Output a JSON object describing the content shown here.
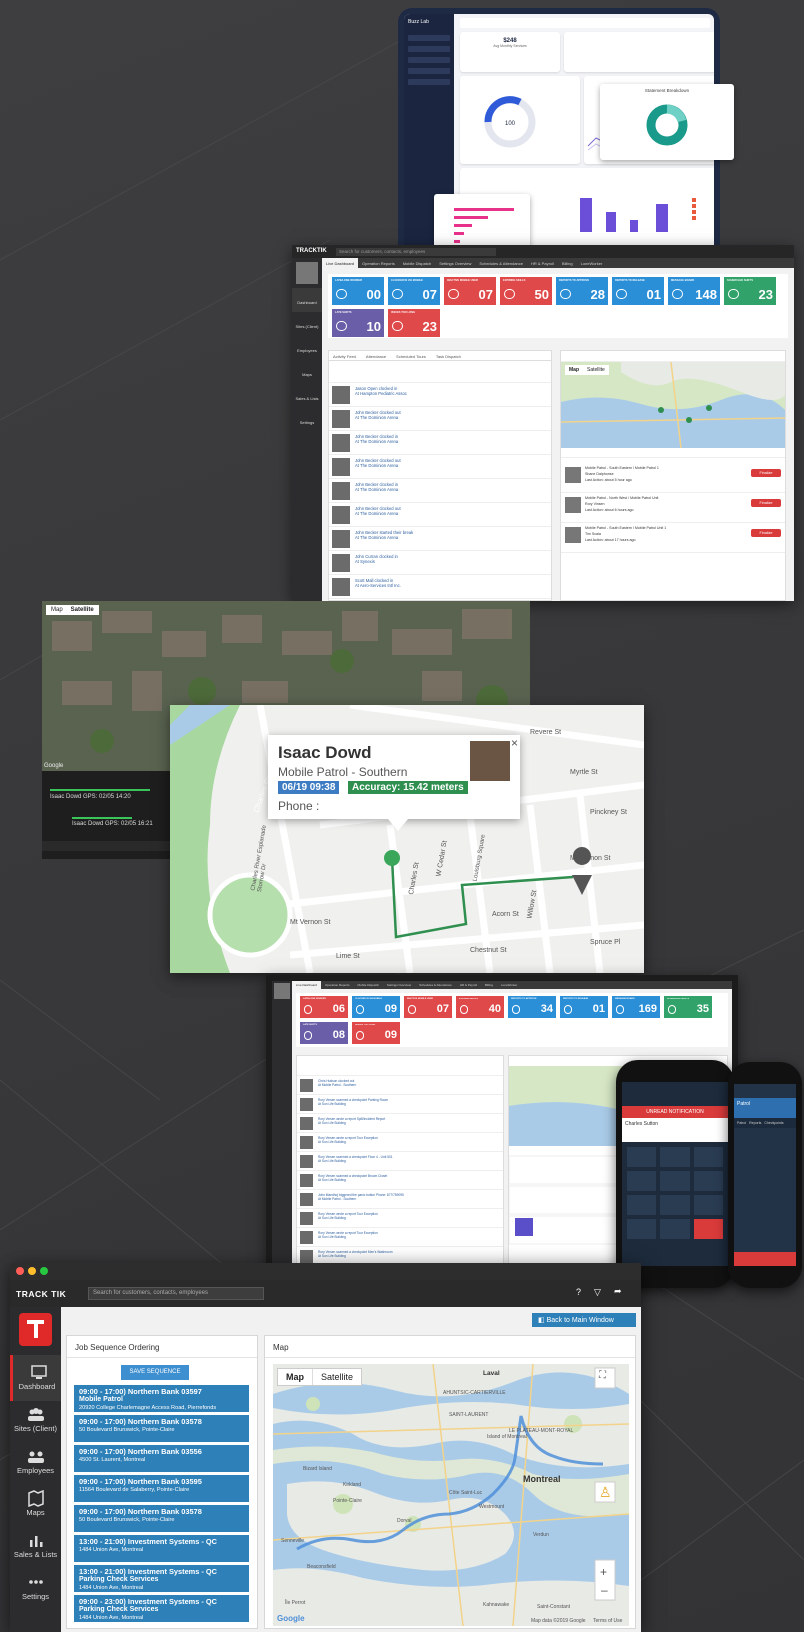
{
  "colors": {
    "tile_blue": "#2b8fd8",
    "tile_red": "#e0494a",
    "tile_green": "#31a26a",
    "tile_purple": "#6b5ea8",
    "tile_teal": "#1c9f9a",
    "job_blue": "#2e80b8",
    "route_blue": "#4f8fd8",
    "route_green": "#2f8f4f",
    "brand_red": "#e02a2a"
  },
  "tablet": {
    "brand": "Buzz Lab",
    "stat1_value": "$248",
    "stat1_label": "Avg Monthly Services",
    "donut_value": "100",
    "card_title": "Statement Breakdown"
  },
  "dashboard_top": {
    "search_placeholder": "Search for customers, contacts, employees",
    "brand": "TRACKTIK",
    "tabs": [
      "Live Dashboard",
      "Operation Reports",
      "Mobile Dispatch",
      "Settings Overview",
      "Schedules & Attendance",
      "HR & Payroll",
      "Billing",
      "LoneWorker"
    ],
    "nav": [
      "Dashboard",
      "Sites (Client)",
      "Employees",
      "Maps",
      "Sales & Lists",
      "Settings"
    ],
    "tiles": [
      {
        "label": "LATE/LONE WORKER",
        "value": "00",
        "color": "#2b8fd8"
      },
      {
        "label": "CLOCKED IN VIA MOBILE",
        "value": "07",
        "color": "#2b8fd8"
      },
      {
        "label": "INACTIVE MOBILE USER",
        "value": "07",
        "color": "#e0494a"
      },
      {
        "label": "EXPIRING SKILLS",
        "value": "50",
        "color": "#e0494a"
      },
      {
        "label": "REPORTS TO APPROVE",
        "value": "28",
        "color": "#2b8fd8"
      },
      {
        "label": "REPORTS TO RELEASE",
        "value": "01",
        "color": "#2b8fd8"
      },
      {
        "label": "MESSAGE BOARD",
        "value": "148",
        "color": "#2b8fd8"
      },
      {
        "label": "SCHEDULED SHIFTS",
        "value": "23",
        "color": "#31a26a"
      },
      {
        "label": "LATE SHIFTS",
        "value": "10",
        "color": "#6b5ea8"
      },
      {
        "label": "ISSUES TOO LONG",
        "value": "23",
        "color": "#e0494a"
      }
    ],
    "feed_tabs": [
      "Activity Feed",
      "Attendance",
      "Scheduled Tours",
      "Task Dispatch"
    ],
    "feed": [
      {
        "who": "Jason Open clocked in",
        "site": "At Hampton Pediatric Assoc"
      },
      {
        "who": "John Becker clocked out",
        "site": "At The Dominion Arena"
      },
      {
        "who": "John Becker clocked in",
        "site": "At The Dominion Arena"
      },
      {
        "who": "John Becker clocked out",
        "site": "At The Dominion Arena"
      },
      {
        "who": "John Becker clocked in",
        "site": "At The Dominion Arena"
      },
      {
        "who": "John Becker clocked out",
        "site": "At The Dominion Arena"
      },
      {
        "who": "John Becker started their break",
        "site": "At The Dominion Arena"
      },
      {
        "who": "John Curran clocked in",
        "site": "At Synexis"
      },
      {
        "who": "Scott Mall clocked in",
        "site": "At Aero-Services Intl Inc."
      }
    ],
    "map_tabs": [
      "Map",
      "Satellite"
    ],
    "patrols": [
      {
        "title": "Mobile Patrol - South Eastern / Mobile Patrol 1",
        "name": "Shane Dalphonse",
        "status": "Last Action: about 5 hour ago",
        "btn": "Finalize"
      },
      {
        "title": "Mobile Patrol - North West / Mobile Patrol Unit",
        "name": "Rory Vinsen",
        "status": "Last Action: about 6 hours ago",
        "btn": "Finalize"
      },
      {
        "title": "Mobile Patrol - South Eastern / Mobile Patrol Unit 1",
        "name": "Tim Scala",
        "status": "Last Action: about 17 hours ago",
        "btn": "Finalize"
      }
    ]
  },
  "satellite": {
    "tabs": [
      "Map",
      "Satellite"
    ],
    "google": "Google",
    "gps": [
      "Isaac Dowd  GPS: 02/05 14:20",
      "Isaac Dowd  GPS: 02/05 16:21"
    ]
  },
  "streetmap": {
    "name": "Isaac Dowd",
    "role": "Mobile Patrol - Southern",
    "date": "06/19 09:38",
    "accuracy": "Accuracy: 15.42 meters",
    "phone": "Phone :",
    "close": "×",
    "streets": [
      "Charles River",
      "Revere St",
      "Myrtle St",
      "Pinckney St",
      "Charles St",
      "Acorn St",
      "Mt Vernon St",
      "W Cedar St",
      "Willow St",
      "Chestnut St",
      "Spruce Pl",
      "Lime St",
      "Mt Vernon St",
      "Storrow Dr",
      "Charles River Esplanade",
      "Louisburg Square"
    ]
  },
  "dashboard_mid": {
    "tabs": [
      "Live Dashboard",
      "Operation Reports",
      "Mobile Dispatch",
      "Settings Overview",
      "Schedules & Attendance",
      "HR & Payroll",
      "Billing",
      "LoneWorker"
    ],
    "tiles": [
      {
        "label": "LATE/LONE WORKER",
        "value": "06",
        "color": "#e0494a"
      },
      {
        "label": "CLOCKED IN VIA MOBILE",
        "value": "09",
        "color": "#2b8fd8"
      },
      {
        "label": "INACTIVE MOBILE USER",
        "value": "07",
        "color": "#e0494a"
      },
      {
        "label": "EXPIRING SKILLS",
        "value": "40",
        "color": "#e0494a"
      },
      {
        "label": "REPORTS TO APPROVE",
        "value": "34",
        "color": "#2b8fd8"
      },
      {
        "label": "REPORTS TO RELEASE",
        "value": "01",
        "color": "#2b8fd8"
      },
      {
        "label": "MESSAGE BOARD",
        "value": "169",
        "color": "#2b8fd8"
      },
      {
        "label": "SCHEDULED SHIFTS",
        "value": "35",
        "color": "#31a26a"
      },
      {
        "label": "LATE SHIFTS",
        "value": "08",
        "color": "#6b5ea8"
      },
      {
        "label": "ISSUES TOO LONG",
        "value": "09",
        "color": "#e0494a"
      }
    ],
    "feed": [
      {
        "who": "Chris Hudson clocked out",
        "site": "At Mobile Patrol - Southern"
      },
      {
        "who": "Rory Vinsen scanned a checkpoint Parking Room",
        "site": "At Sun Life Building"
      },
      {
        "who": "Rory Vinsen wrote a report Spill/Incident Report",
        "site": "At Sun Life Building"
      },
      {
        "who": "Rory Vinsen wrote a report Tour Exception",
        "site": "At Sun Life Building"
      },
      {
        "who": "Rory Vinsen scanned a checkpoint Floor 4 - Unit 501",
        "site": "At Sun Life Building"
      },
      {
        "who": "Rory Vinsen scanned a checkpoint Broom Closet",
        "site": "At Sun Life Building"
      },
      {
        "who": "John Mandhoj triggered the panic button Phone: 877/759095",
        "site": "At Mobile Patrol - Southern"
      },
      {
        "who": "Rory Vinsen wrote a report Tour Exception",
        "site": "At Sun Life Building"
      },
      {
        "who": "Rory Vinsen wrote a report Tour Exception",
        "site": "At Sun Life Building"
      },
      {
        "who": "Rory Vinsen scanned a checkpoint Men's Washroom",
        "site": "At Sun Life Building"
      }
    ]
  },
  "phones": {
    "left_banner": "UNREAD NOTIFICATION",
    "left_name": "Charles Sutton",
    "right_title": "Patrol",
    "right_tabs": [
      "Patrol",
      "Reports",
      "Checkpoints"
    ]
  },
  "app": {
    "brand": "TRACK TIK",
    "search_placeholder": "Search for customers, contacts, employees",
    "back_button": "Back to Main Window",
    "nav": [
      "Dashboard",
      "Sites (Client)",
      "Employees",
      "Maps",
      "Sales & Lists",
      "Settings"
    ],
    "jobs_title": "Job Sequence Ordering",
    "save_button": "SAVE SEQUENCE",
    "jobs": [
      {
        "title": "09:00 - 17:00) Northern Bank 03597",
        "sub": "Mobile Patrol",
        "addr": "20920 College Charlemagne Access Road, Pierrefonds"
      },
      {
        "title": "09:00 - 17:00) Northern Bank 03578",
        "sub": "",
        "addr": "50 Boulevard Brunswick, Pointe-Claire"
      },
      {
        "title": "09:00 - 17:00) Northern Bank 03556",
        "sub": "",
        "addr": "4500 St. Laurent, Montreal"
      },
      {
        "title": "09:00 - 17:00) Northern Bank 03595",
        "sub": "",
        "addr": "11564 Boulevard de Salaberry, Pointe-Claire"
      },
      {
        "title": "09:00 - 17:00) Northern Bank 03578",
        "sub": "",
        "addr": "50 Boulevard Brunswick, Pointe-Claire"
      },
      {
        "title": "13:00 - 21:00) Investment Systems - QC",
        "sub": "",
        "addr": "1484 Union Ave, Montreal"
      },
      {
        "title": "13:00 - 21:00) Investment Systems - QC",
        "sub": "Parking Check Services",
        "addr": "1484 Union Ave, Montreal"
      },
      {
        "title": "09:00 - 23:00) Investment Systems - QC",
        "sub": "Parking Check Services",
        "addr": "1484 Union Ave, Montreal"
      }
    ],
    "map_title": "Map",
    "map_tabs": [
      "Map",
      "Satellite"
    ],
    "places": [
      "Laval",
      "Montreal",
      "Island of Montreal",
      "Pointe-Claire",
      "Dorval",
      "Bizard Island",
      "Kirkland",
      "Beaconsfield",
      "Senneville",
      "Côte Saint-Luc",
      "Verdun",
      "Westmount",
      "AHUNTSIC-CARTIERVILLE",
      "LE PLATEAU-MONT-ROYAL",
      "SAINT-LAURENT",
      "Kahnawake",
      "Saint-Constant",
      "Île Perrot"
    ],
    "map_footer": "Map data ©2019 Google",
    "map_terms": "Terms of Use",
    "google": "Google"
  }
}
